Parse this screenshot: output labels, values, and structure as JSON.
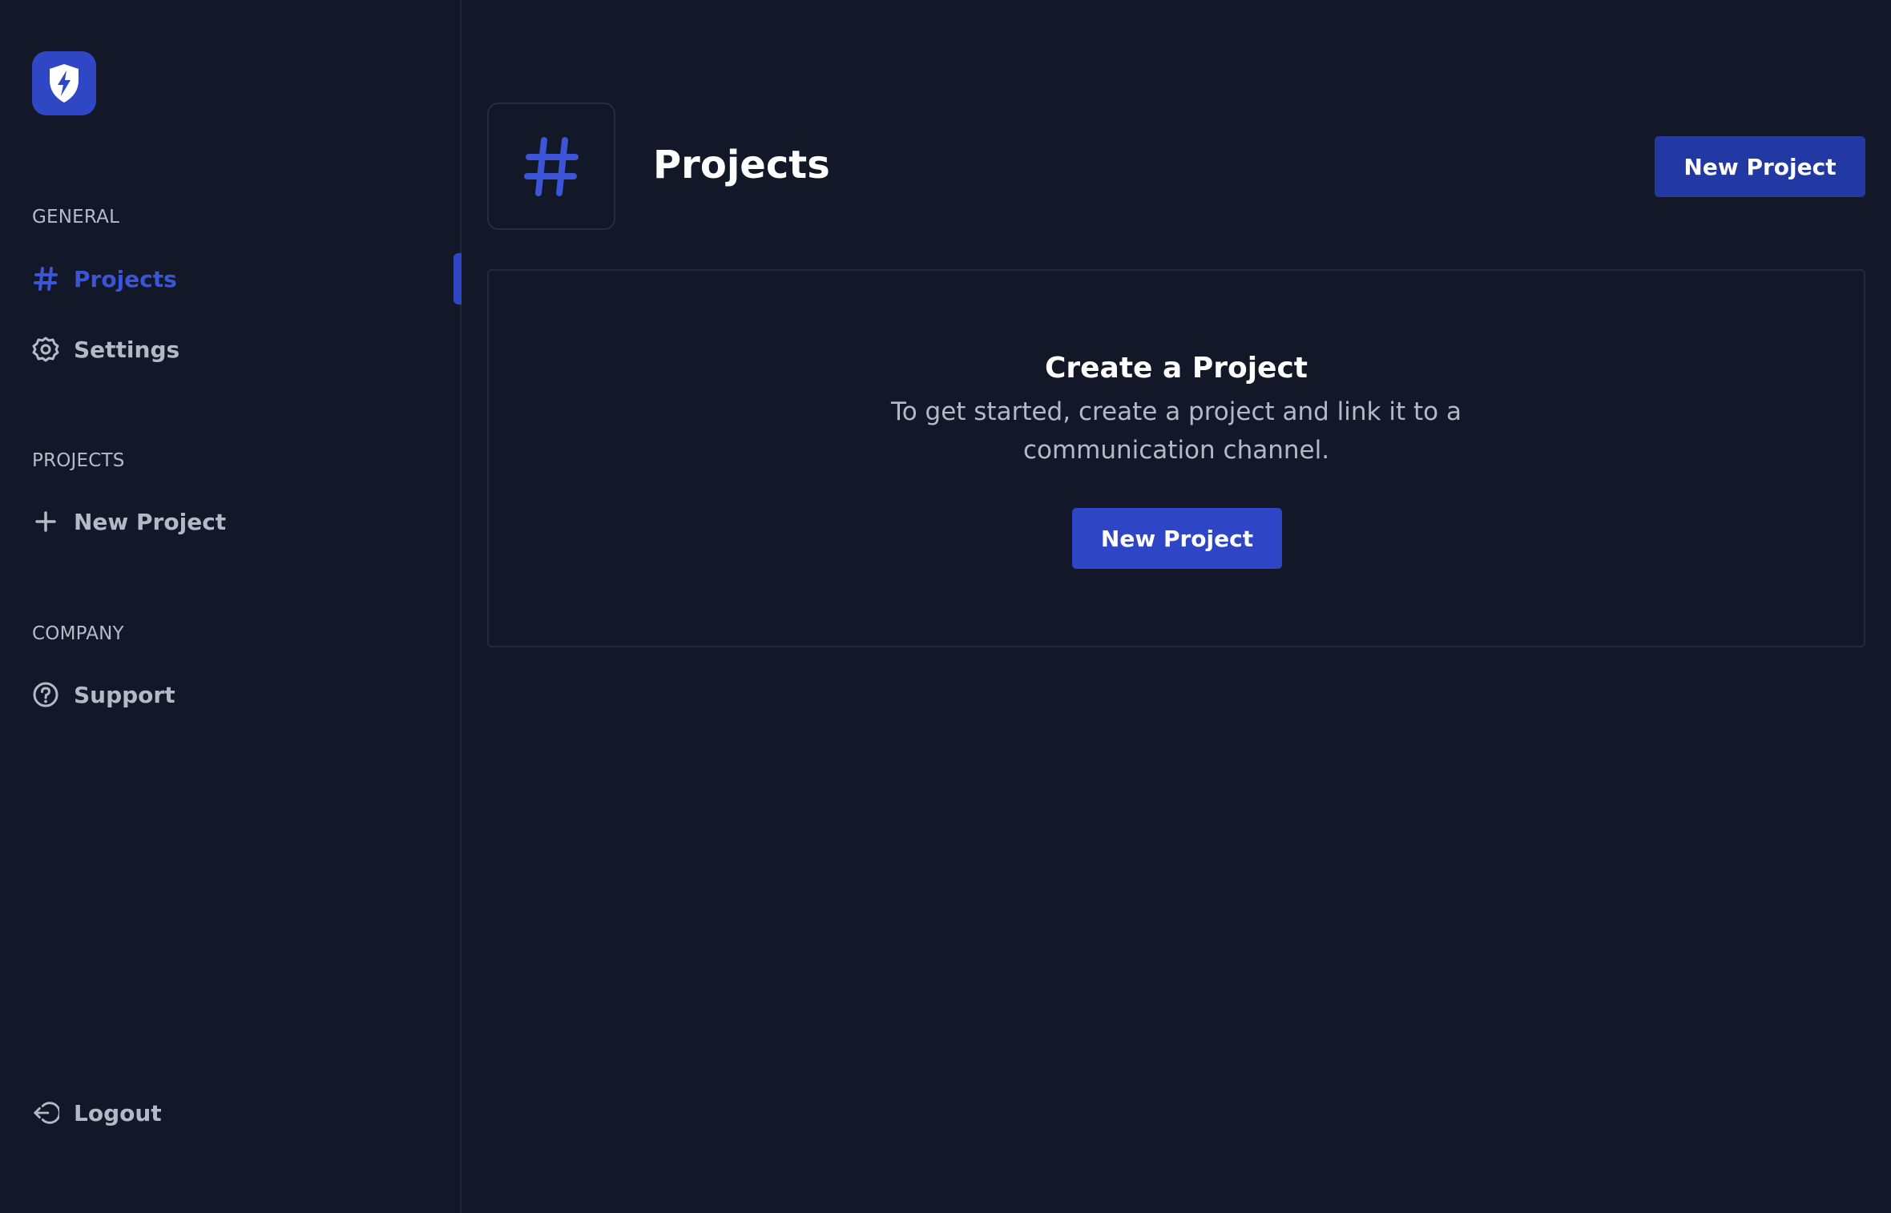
{
  "colors": {
    "background": "#121827",
    "accent": "#2f47c4",
    "active_text": "#3c55d6",
    "muted_text": "#b3b9c6",
    "button_dark": "#2238a3"
  },
  "sidebar": {
    "logo_icon": "shield-lightning-icon",
    "sections": {
      "general": {
        "label": "GENERAL",
        "items": [
          {
            "label": "Projects",
            "icon": "hash-icon",
            "active": true
          },
          {
            "label": "Settings",
            "icon": "gear-icon",
            "active": false
          }
        ]
      },
      "projects": {
        "label": "PROJECTS",
        "items": [
          {
            "label": "New Project",
            "icon": "plus-icon"
          }
        ]
      },
      "company": {
        "label": "COMPANY",
        "items": [
          {
            "label": "Support",
            "icon": "help-circle-icon"
          }
        ]
      }
    },
    "logout": {
      "label": "Logout",
      "icon": "logout-icon"
    }
  },
  "header": {
    "icon": "hash-icon",
    "title": "Projects",
    "new_project_label": "New Project"
  },
  "empty_state": {
    "title": "Create a Project",
    "description": "To get started, create a project and link it to a communication channel.",
    "button_label": "New Project"
  }
}
